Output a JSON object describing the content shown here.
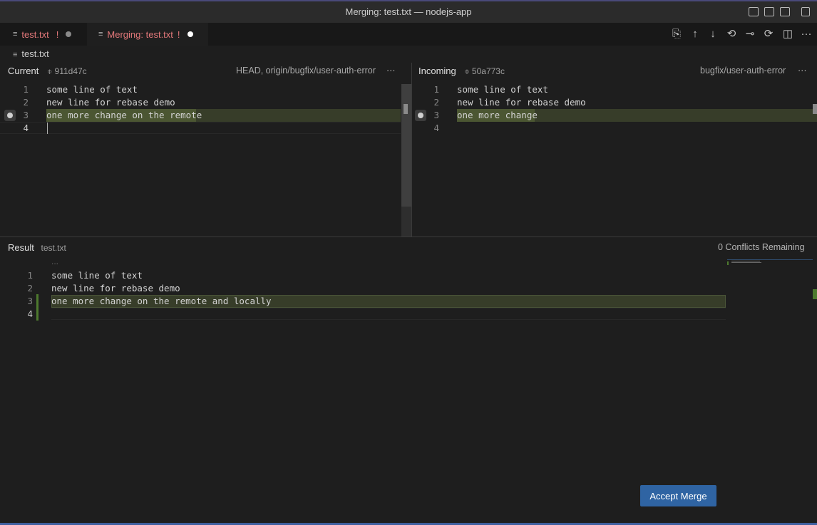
{
  "window": {
    "title": "Merging: test.txt — nodejs-app"
  },
  "tabs": [
    {
      "label": "test.txt",
      "badge": "!",
      "active": false
    },
    {
      "label": "Merging: test.txt",
      "badge": "!",
      "active": true
    }
  ],
  "breadcrumb": "test.txt",
  "current": {
    "label": "Current",
    "commit": "911d47c",
    "ref": "HEAD, origin/bugfix/user-auth-error",
    "lines": [
      {
        "n": "1",
        "text": "some line of text"
      },
      {
        "n": "2",
        "text": "new line for rebase demo"
      },
      {
        "n": "3",
        "text": "one more change on the remote"
      },
      {
        "n": "4",
        "text": ""
      }
    ]
  },
  "incoming": {
    "label": "Incoming",
    "commit": "50a773c",
    "ref": "bugfix/user-auth-error",
    "lines": [
      {
        "n": "1",
        "text": "some line of text"
      },
      {
        "n": "2",
        "text": "new line for rebase demo"
      },
      {
        "n": "3",
        "text": "one more change"
      },
      {
        "n": "4",
        "text": ""
      }
    ]
  },
  "result": {
    "label": "Result",
    "file": "test.txt",
    "status": "0 Conflicts Remaining",
    "fold": "...",
    "lines": [
      {
        "n": "1",
        "text": "some line of text"
      },
      {
        "n": "2",
        "text": "new line for rebase demo"
      },
      {
        "n": "3",
        "text": "one more change on the remote and locally"
      },
      {
        "n": "4",
        "text": ""
      }
    ]
  },
  "buttons": {
    "accept": "Accept Merge",
    "more": "···"
  },
  "icons": {
    "file": "file-lines-icon",
    "commit": "git-commit-icon",
    "actions": [
      "open-file-icon",
      "arrow-up-icon",
      "arrow-down-icon",
      "accept-left-icon",
      "accept-both-icon",
      "accept-right-icon",
      "split-editor-icon",
      "more-icon"
    ]
  },
  "colors": {
    "accent": "#2f64a3",
    "modified": "#e3787a",
    "highlight": "#373d29",
    "highlight_word": "#4b5632"
  }
}
